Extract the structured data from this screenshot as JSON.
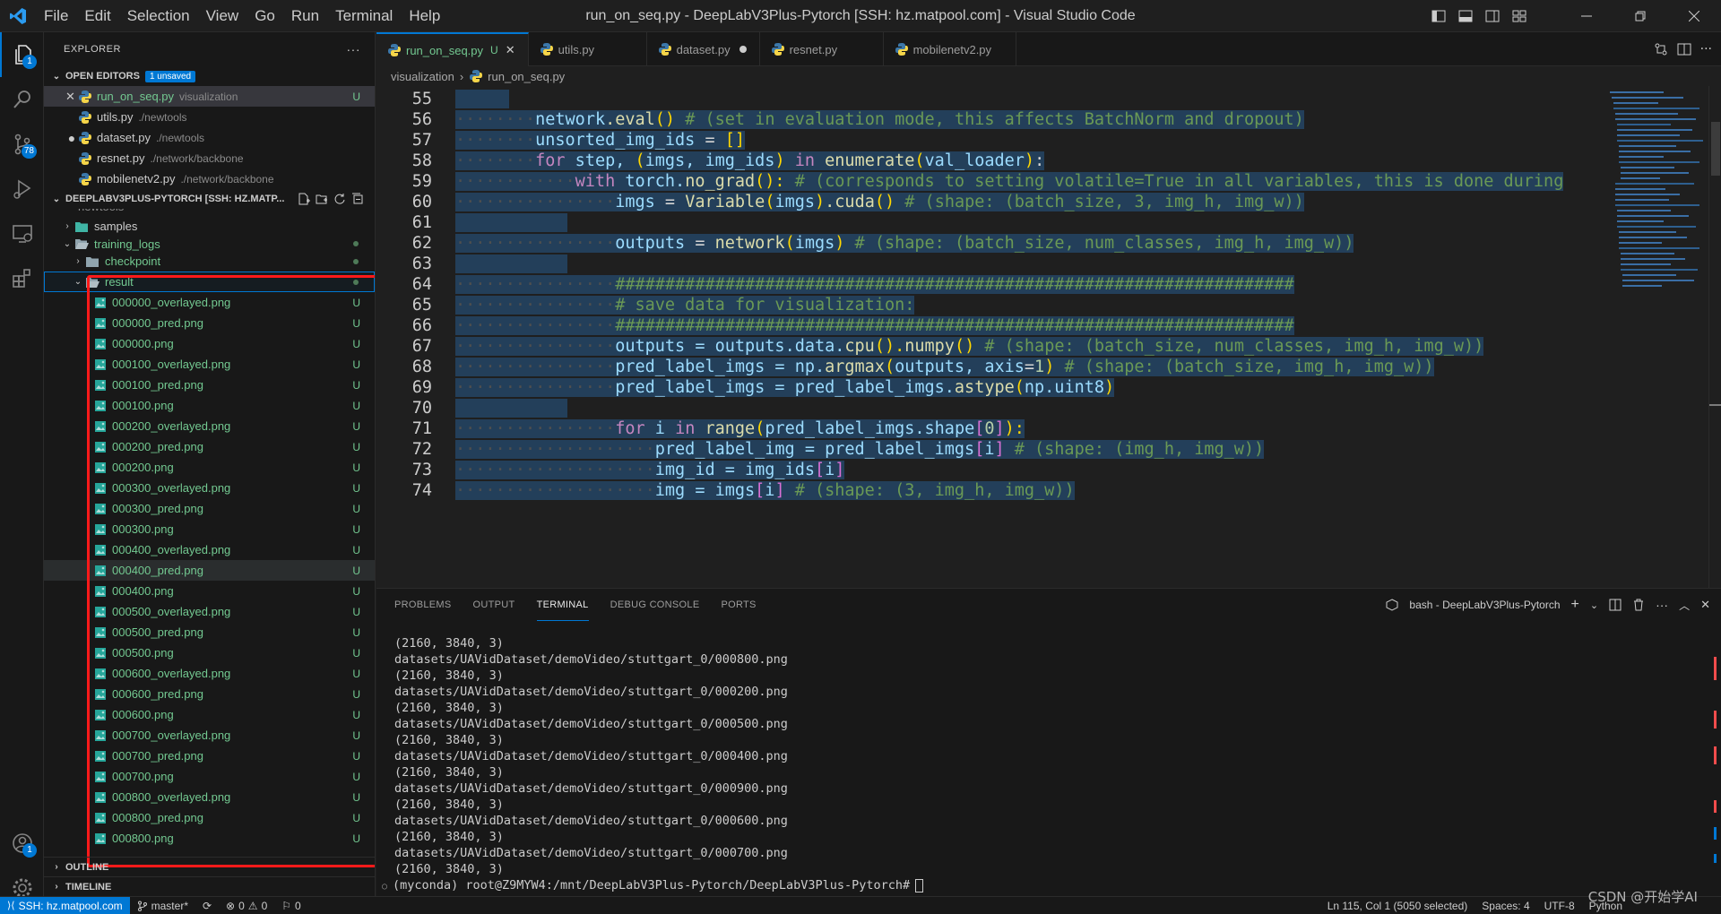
{
  "titlebar": {
    "menus": [
      "File",
      "Edit",
      "Selection",
      "View",
      "Go",
      "Run",
      "Terminal",
      "Help"
    ],
    "title": "run_on_seq.py - DeepLabV3Plus-Pytorch [SSH: hz.matpool.com] - Visual Studio Code"
  },
  "activity": {
    "explorer_badge": "1",
    "scm_badge": "78",
    "accounts_badge": "1"
  },
  "sidebar": {
    "title": "EXPLORER",
    "more": "···",
    "open_editors": {
      "label": "OPEN EDITORS",
      "badge": "1 unsaved",
      "items": [
        {
          "name": "run_on_seq.py",
          "desc": "visualization",
          "status": "U"
        },
        {
          "name": "utils.py",
          "desc": "./newtools",
          "status": ""
        },
        {
          "name": "dataset.py",
          "desc": "./newtools",
          "status": ""
        },
        {
          "name": "resnet.py",
          "desc": "./network/backbone",
          "status": ""
        },
        {
          "name": "mobilenetv2.py",
          "desc": "./network/backbone",
          "status": ""
        }
      ]
    },
    "workspace": {
      "label": "DEEPLABV3PLUS-PYTORCH [SSH: HZ.MATP...",
      "partial": "newtools",
      "samples": "samples",
      "training_logs": "training_logs",
      "checkpoint": "checkpoint",
      "result": "result",
      "files": [
        "000000_overlayed.png",
        "000000_pred.png",
        "000000.png",
        "000100_overlayed.png",
        "000100_pred.png",
        "000100.png",
        "000200_overlayed.png",
        "000200_pred.png",
        "000200.png",
        "000300_overlayed.png",
        "000300_pred.png",
        "000300.png",
        "000400_overlayed.png",
        "000400_pred.png",
        "000400.png",
        "000500_overlayed.png",
        "000500_pred.png",
        "000500.png",
        "000600_overlayed.png",
        "000600_pred.png",
        "000600.png",
        "000700_overlayed.png",
        "000700_pred.png",
        "000700.png",
        "000800_overlayed.png",
        "000800_pred.png",
        "000800.png"
      ],
      "file_status": "U"
    },
    "outline": "OUTLINE",
    "timeline": "TIMELINE"
  },
  "editor": {
    "tabs": [
      {
        "name": "run_on_seq.py",
        "status": "U",
        "active": true
      },
      {
        "name": "utils.py",
        "status": "",
        "active": false
      },
      {
        "name": "dataset.py",
        "status": "dot",
        "active": false
      },
      {
        "name": "resnet.py",
        "status": "",
        "active": false
      },
      {
        "name": "mobilenetv2.py",
        "status": "",
        "active": false
      }
    ],
    "breadcrumb": [
      "visualization",
      "run_on_seq.py"
    ],
    "line_numbers": [
      "55",
      "56",
      "57",
      "58",
      "59",
      "60",
      "61",
      "62",
      "63",
      "64",
      "65",
      "66",
      "67",
      "68",
      "69",
      "70",
      "71",
      "72",
      "73",
      "74"
    ],
    "code": {
      "l56a": "network",
      "l56b": ".eval",
      "l56c": "()",
      "l56d": " # (set in evaluation mode, this affects BatchNorm and dropout)",
      "l57a": "unsorted_img_ids",
      "l57b": " = ",
      "l57c": "[]",
      "l58a": "for",
      "l58b": " step, ",
      "l58c": "(",
      "l58d": "imgs, img_ids",
      "l58e": ")",
      "l58f": " in ",
      "l58g": "enumerate",
      "l58h": "(",
      "l58i": "val_loader",
      "l58j": ")",
      "l58k": ":",
      "l59a": "with",
      "l59b": " torch.",
      "l59c": "no_grad",
      "l59d": "():",
      "l59e": " # (corresponds to setting volatile=True in all variables, this is done during",
      "l60a": "imgs",
      "l60b": " = ",
      "l60c": "Variable",
      "l60d": "(",
      "l60e": "imgs",
      "l60f": ")",
      "l60g": ".cuda",
      "l60h": "()",
      "l60i": " # (shape: (batch_size, 3, img_h, img_w))",
      "l62a": "outputs",
      "l62b": " = ",
      "l62c": "network",
      "l62d": "(",
      "l62e": "imgs",
      "l62f": ")",
      "l62g": " # (shape: (batch_size, num_classes, img_h, img_w))",
      "l64": "####################################################################",
      "l65": "# save data for visualization:",
      "l66": "####################################################################",
      "l67a": "outputs",
      "l67b": " = outputs.data.",
      "l67c": "cpu",
      "l67d": "().",
      "l67e": "numpy",
      "l67f": "()",
      "l67g": " # (shape: (batch_size, num_classes, img_h, img_w))",
      "l68a": "pred_label_imgs",
      "l68b": " = np.",
      "l68c": "argmax",
      "l68d": "(",
      "l68e": "outputs, ",
      "l68f": "axis",
      "l68g": "=",
      "l68h": "1",
      "l68i": ")",
      "l68j": " # (shape: (batch_size, img_h, img_w))",
      "l69a": "pred_label_imgs",
      "l69b": " = pred_label_imgs.",
      "l69c": "astype",
      "l69d": "(",
      "l69e": "np.uint8",
      "l69f": ")",
      "l71a": "for",
      "l71b": " i ",
      "l71c": "in",
      "l71d": " ",
      "l71e": "range",
      "l71f": "(",
      "l71g": "pred_label_imgs.shape",
      "l71h": "[",
      "l71i": "0",
      "l71j": "]",
      "l71k": "):",
      "l72a": "pred_label_img",
      "l72b": " = pred_label_imgs",
      "l72c": "[",
      "l72d": "i",
      "l72e": "]",
      "l72f": " # (shape: (img_h, img_w))",
      "l73a": "img_id",
      "l73b": " = img_ids",
      "l73c": "[",
      "l73d": "i",
      "l73e": "]",
      "l74a": "img",
      "l74b": " = imgs",
      "l74c": "[",
      "l74d": "i",
      "l74e": "]",
      "l74f": " # (shape: (3, img_h, img_w))"
    }
  },
  "panel": {
    "tabs": [
      "PROBLEMS",
      "OUTPUT",
      "TERMINAL",
      "DEBUG CONSOLE",
      "PORTS"
    ],
    "terminal_name": "bash - DeepLabV3Plus-Pytorch",
    "lines": [
      "(2160, 3840, 3)",
      "datasets/UAVidDataset/demoVideo/stuttgart_0/000800.png",
      "(2160, 3840, 3)",
      "datasets/UAVidDataset/demoVideo/stuttgart_0/000200.png",
      "(2160, 3840, 3)",
      "datasets/UAVidDataset/demoVideo/stuttgart_0/000500.png",
      "(2160, 3840, 3)",
      "datasets/UAVidDataset/demoVideo/stuttgart_0/000400.png",
      "(2160, 3840, 3)",
      "datasets/UAVidDataset/demoVideo/stuttgart_0/000900.png",
      "(2160, 3840, 3)",
      "datasets/UAVidDataset/demoVideo/stuttgart_0/000600.png",
      "(2160, 3840, 3)",
      "datasets/UAVidDataset/demoVideo/stuttgart_0/000700.png",
      "(2160, 3840, 3)"
    ],
    "prompt": "(myconda) root@Z9MYW4:/mnt/DeepLabV3Plus-Pytorch/DeepLabV3Plus-Pytorch#"
  },
  "statusbar": {
    "remote": "SSH: hz.matpool.com",
    "branch": "master*",
    "errors": "0",
    "warnings": "0",
    "ports": "0",
    "position": "Ln 115, Col 1 (5050 selected)",
    "spaces": "Spaces: 4",
    "encoding": "UTF-8",
    "language": "Python"
  },
  "watermark": "CSDN @开始学AI",
  "colors": {
    "accent": "#0078d4",
    "git_untracked": "#73c991",
    "annotation": "#ff1a1a"
  }
}
